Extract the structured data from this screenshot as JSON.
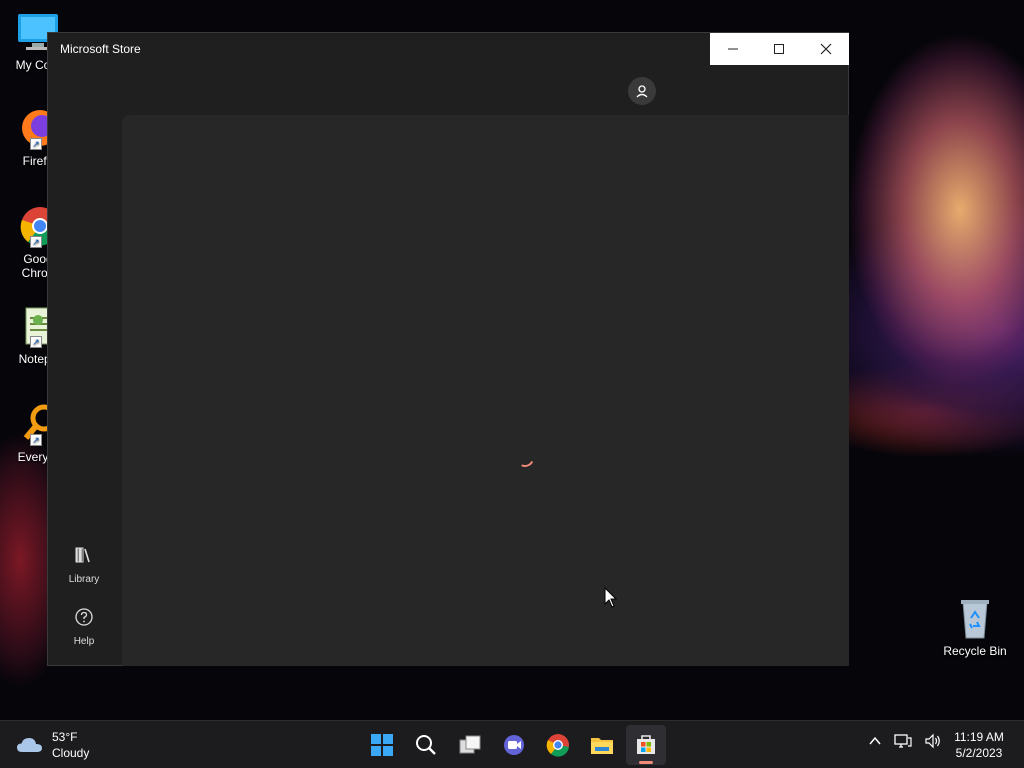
{
  "desktop": {
    "icons": [
      {
        "label": "My Com",
        "icon": "computer-icon"
      },
      {
        "label": "Firefo",
        "icon": "firefox-icon"
      },
      {
        "label": "Goog\nChron",
        "icon": "chrome-icon"
      },
      {
        "label": "Notepa",
        "icon": "notepad-icon"
      },
      {
        "label": "Everyth",
        "icon": "everything-icon"
      }
    ],
    "recycle_bin": {
      "label": "Recycle Bin",
      "icon": "recycle-bin-icon"
    }
  },
  "window": {
    "title": "Microsoft Store",
    "caption": {
      "minimize": "—",
      "maximize": "☐",
      "close": "✕"
    },
    "nav": [
      {
        "label": "Library",
        "icon": "library-icon"
      },
      {
        "label": "Help",
        "icon": "help-icon"
      }
    ],
    "loading": true
  },
  "taskbar": {
    "weather": {
      "temp": "53°F",
      "condition": "Cloudy"
    },
    "apps": [
      "start-icon",
      "search-icon",
      "task-view-icon",
      "chat-icon",
      "chrome-icon",
      "file-explorer-icon",
      "microsoft-store-icon"
    ],
    "active_app": "microsoft-store-icon",
    "clock": {
      "time": "11:19 AM",
      "date": "5/2/2023"
    }
  },
  "colors": {
    "accent": "#f08a7a",
    "window_bg": "#1f1f1f",
    "content_bg": "#272727",
    "taskbar_bg": "#1c1c1f"
  }
}
